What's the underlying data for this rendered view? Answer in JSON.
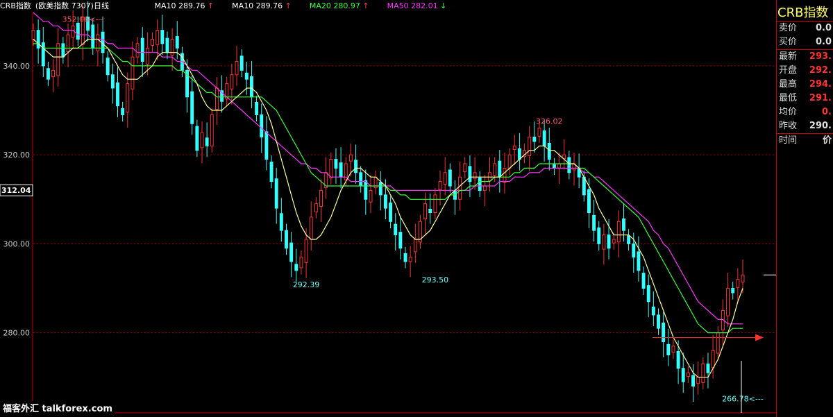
{
  "header": {
    "title": "CRB指数",
    "subtitle": "(欧美指数 7307)日线",
    "indicators": [
      {
        "label": "MA10 289.76",
        "arrow": "↑",
        "cls": "h-ma10",
        "arrow_cls": "up"
      },
      {
        "label": "MA10 289.76",
        "arrow": "↑",
        "cls": "h-ma10",
        "arrow_cls": "up"
      },
      {
        "label": "MA20 280.97",
        "arrow": "↑",
        "cls": "h-ma20",
        "arrow_cls": "up"
      },
      {
        "label": "MA50 282.01",
        "arrow": "↓",
        "cls": "h-ma50",
        "arrow_cls": "down"
      }
    ]
  },
  "panel": {
    "title": "CRB指数",
    "rows": [
      {
        "label": "卖价",
        "value": "0.0",
        "style": "p-val"
      },
      {
        "label": "买价",
        "value": "0.0",
        "style": "p-val"
      },
      {
        "label": "最新",
        "value": "293.",
        "style": "p-red"
      },
      {
        "label": "开盘",
        "value": "292.",
        "style": "p-red"
      },
      {
        "label": "最高",
        "value": "294.",
        "style": "p-red"
      },
      {
        "label": "最低",
        "value": "291.",
        "style": "p-red"
      },
      {
        "label": "均价",
        "value": "0.",
        "style": "p-red"
      },
      {
        "label": "昨收",
        "value": "290.",
        "style": "p-val"
      },
      {
        "label": "时间",
        "value": "价",
        "style": "p-val"
      }
    ]
  },
  "watermark": "福客外汇 talkforex.com",
  "chart_data": {
    "type": "candlestick",
    "ylim": [
      262,
      352
    ],
    "yticks": [
      "340.00",
      "320.00",
      "300.00",
      "280.00"
    ],
    "ytick_values": [
      340,
      320,
      300,
      280
    ],
    "current_label": "312.04",
    "current_value": 312.04,
    "annotations": [
      {
        "text": "352.06<---",
        "value": 352.06,
        "index": 10
      },
      {
        "text": "292.39",
        "value": 292.39,
        "index": 55
      },
      {
        "text": "293.50",
        "value": 293.5,
        "index": 81
      },
      {
        "text": "326.02",
        "value": 326.02,
        "index": 104
      },
      {
        "text": "266.78<---",
        "value": 266.78,
        "index": 143
      }
    ],
    "close_series": [
      348,
      344,
      340,
      337,
      339,
      345,
      342,
      347,
      349,
      346,
      351,
      348,
      344,
      347,
      343,
      338,
      335,
      331,
      329,
      336,
      342,
      345,
      341,
      344,
      346,
      348,
      345,
      343,
      346,
      344,
      339,
      333,
      327,
      321,
      325,
      322,
      329,
      335,
      332,
      336,
      338,
      341,
      339,
      337,
      333,
      329,
      324,
      319,
      314,
      308,
      303,
      299,
      296,
      294,
      297,
      301,
      306,
      309,
      312,
      316,
      319,
      317,
      315,
      318,
      320,
      316,
      313,
      310,
      312,
      315,
      311,
      308,
      305,
      302,
      299,
      296,
      297,
      301,
      305,
      309,
      307,
      311,
      314,
      316,
      313,
      310,
      315,
      318,
      314,
      316,
      312,
      313,
      316,
      318,
      315,
      317,
      320,
      322,
      319,
      321,
      324,
      323,
      326,
      322,
      319,
      317,
      318,
      320,
      316,
      318,
      315,
      311,
      307,
      303,
      300,
      302,
      299,
      301,
      305,
      303,
      300,
      297,
      294,
      290,
      287,
      284,
      281,
      278,
      275,
      277,
      272,
      269,
      271,
      268,
      270,
      273,
      271,
      276,
      280,
      285,
      290,
      289,
      292,
      293
    ],
    "ma10": [
      346,
      345,
      344,
      343,
      342,
      342,
      342,
      343,
      344,
      344,
      345,
      346,
      346,
      346,
      345,
      344,
      342,
      340,
      338,
      337,
      337,
      337,
      338,
      339,
      340,
      342,
      343,
      343,
      343,
      343,
      342,
      340,
      338,
      336,
      333,
      331,
      330,
      330,
      330,
      331,
      332,
      333,
      334,
      335,
      335,
      334,
      332,
      330,
      327,
      323,
      319,
      315,
      311,
      307,
      304,
      302,
      301,
      301,
      302,
      304,
      306,
      309,
      312,
      314,
      316,
      317,
      317,
      316,
      315,
      315,
      314,
      313,
      311,
      309,
      306,
      304,
      302,
      301,
      301,
      302,
      303,
      305,
      307,
      309,
      311,
      312,
      313,
      314,
      315,
      315,
      315,
      315,
      315,
      315,
      315,
      316,
      317,
      318,
      319,
      320,
      321,
      321,
      322,
      322,
      321,
      321,
      320,
      319,
      318,
      318,
      317,
      315,
      313,
      311,
      308,
      306,
      304,
      302,
      302,
      302,
      302,
      301,
      299,
      297,
      294,
      291,
      288,
      285,
      282,
      279,
      277,
      275,
      273,
      271,
      270,
      270,
      270,
      272,
      274,
      277,
      280,
      283,
      287,
      290
    ],
    "ma20": [
      345,
      345,
      344,
      344,
      344,
      344,
      344,
      344,
      344,
      344,
      344,
      344,
      344,
      344,
      344,
      344,
      343,
      342,
      341,
      341,
      340,
      340,
      340,
      340,
      340,
      340,
      340,
      340,
      340,
      339,
      339,
      338,
      337,
      336,
      335,
      334,
      334,
      333,
      333,
      333,
      333,
      333,
      333,
      333,
      333,
      333,
      333,
      332,
      331,
      330,
      328,
      326,
      324,
      322,
      320,
      318,
      316,
      315,
      314,
      313,
      313,
      313,
      313,
      313,
      313,
      313,
      313,
      313,
      313,
      313,
      313,
      313,
      312,
      312,
      311,
      311,
      310,
      310,
      310,
      310,
      310,
      310,
      310,
      310,
      311,
      311,
      312,
      312,
      313,
      313,
      314,
      314,
      314,
      315,
      315,
      315,
      315,
      316,
      316,
      317,
      317,
      317,
      318,
      318,
      318,
      318,
      318,
      318,
      318,
      318,
      317,
      317,
      316,
      315,
      314,
      313,
      312,
      311,
      310,
      309,
      308,
      307,
      306,
      304,
      302,
      300,
      298,
      296,
      294,
      292,
      290,
      288,
      286,
      284,
      282,
      281,
      280,
      280,
      280,
      280,
      280,
      281,
      281,
      281
    ],
    "ma50": [
      352,
      351,
      350,
      350,
      349,
      349,
      348,
      348,
      348,
      347,
      347,
      347,
      346,
      346,
      346,
      345,
      345,
      344,
      344,
      344,
      344,
      343,
      343,
      343,
      343,
      343,
      342,
      342,
      342,
      341,
      341,
      340,
      339,
      339,
      338,
      337,
      336,
      335,
      334,
      333,
      332,
      331,
      330,
      329,
      328,
      327,
      326,
      325,
      324,
      323,
      322,
      321,
      320,
      319,
      318,
      318,
      317,
      317,
      316,
      316,
      315,
      315,
      315,
      315,
      314,
      314,
      314,
      314,
      313,
      313,
      313,
      313,
      313,
      312,
      312,
      312,
      312,
      312,
      312,
      312,
      312,
      312,
      312,
      312,
      312,
      312,
      312,
      312,
      312,
      313,
      313,
      313,
      313,
      313,
      314,
      314,
      314,
      315,
      315,
      315,
      316,
      316,
      316,
      317,
      317,
      317,
      317,
      317,
      317,
      317,
      317,
      316,
      316,
      315,
      315,
      314,
      313,
      312,
      311,
      310,
      309,
      308,
      307,
      306,
      305,
      303,
      302,
      300,
      299,
      297,
      295,
      293,
      291,
      289,
      287,
      286,
      285,
      284,
      283,
      283,
      282,
      282,
      282,
      282
    ]
  }
}
